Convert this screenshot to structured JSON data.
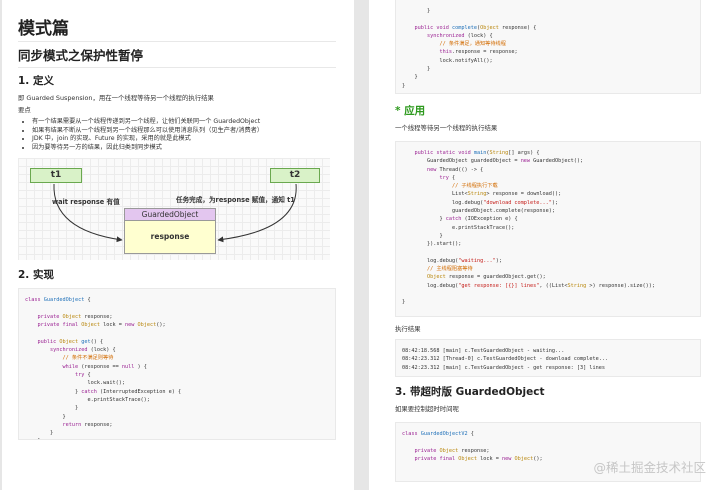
{
  "left": {
    "chapter": "模式篇",
    "section": "同步模式之保护性暂停",
    "h_def": "1. 定义",
    "def_text": "即 Guarded Suspension，用在一个线程等待另一个线程的执行结果",
    "points_label": "要点",
    "bullets": [
      "有一个结果需要从一个线程传递到另一个线程，让他们关联同一个 GuardedObject",
      "如果有结果不断从一个线程到另一个线程那么可以使用消息队列（见生产者/消费者）",
      "JDK 中，join 的实现、Future 的实现，采用的就是此模式",
      "因为要等待另一方的结果，因此归类到同步模式"
    ],
    "diagram": {
      "t1": "t1",
      "t2": "t2",
      "obj_title": "GuardedObject",
      "obj_body": "response",
      "left_label": "wait response 有值",
      "right_label": "任务完成，为response 赋值，通知 t1"
    },
    "h_impl": "2. 实现"
  },
  "right": {
    "h_app": "* 应用",
    "app_text": "一个线程等待另一个线程的执行结果",
    "result_label": "执行结果",
    "h_timeout": "3. 带超时版 GuardedObject",
    "timeout_text": "如果要控制超时时间呢"
  },
  "code1": [
    [
      [
        "k",
        "class"
      ],
      [
        "",
        " "
      ],
      [
        "f",
        "GuardedObject"
      ],
      [
        "",
        " {"
      ]
    ],
    [
      [
        "",
        ""
      ]
    ],
    [
      [
        "",
        "    "
      ],
      [
        "k",
        "private"
      ],
      [
        "",
        " "
      ],
      [
        "t",
        "Object"
      ],
      [
        "",
        " response;"
      ]
    ],
    [
      [
        "",
        "    "
      ],
      [
        "k",
        "private final"
      ],
      [
        "",
        " "
      ],
      [
        "t",
        "Object"
      ],
      [
        "",
        " lock = "
      ],
      [
        "k",
        "new"
      ],
      [
        "",
        " "
      ],
      [
        "t",
        "Object"
      ],
      [
        "",
        "();"
      ]
    ],
    [
      [
        "",
        ""
      ]
    ],
    [
      [
        "",
        "    "
      ],
      [
        "k",
        "public"
      ],
      [
        "",
        " "
      ],
      [
        "t",
        "Object"
      ],
      [
        "",
        " "
      ],
      [
        "f",
        "get"
      ],
      [
        "",
        "() {"
      ]
    ],
    [
      [
        "",
        "        "
      ],
      [
        "k",
        "synchronized"
      ],
      [
        "",
        " (lock) {"
      ]
    ],
    [
      [
        "",
        "            "
      ],
      [
        "c",
        "// 条件不满足则等待"
      ]
    ],
    [
      [
        "",
        "            "
      ],
      [
        "k",
        "while"
      ],
      [
        "",
        " (response == "
      ],
      [
        "k",
        "null"
      ],
      [
        "",
        " ) {"
      ]
    ],
    [
      [
        "",
        "                "
      ],
      [
        "k",
        "try"
      ],
      [
        "",
        " {"
      ]
    ],
    [
      [
        "",
        "                    lock.wait();"
      ]
    ],
    [
      [
        "",
        "                } "
      ],
      [
        "k",
        "catch"
      ],
      [
        "",
        " (InterruptedException e) {"
      ]
    ],
    [
      [
        "",
        "                    e.printStackTrace();"
      ]
    ],
    [
      [
        "",
        "                }"
      ]
    ],
    [
      [
        "",
        "            }"
      ]
    ],
    [
      [
        "",
        "            "
      ],
      [
        "k",
        "return"
      ],
      [
        "",
        " response;"
      ]
    ],
    [
      [
        "",
        "        }"
      ]
    ],
    [
      [
        "",
        "    }"
      ]
    ]
  ],
  "code2": [
    [
      [
        "",
        "        }"
      ]
    ],
    [
      [
        "",
        ""
      ]
    ],
    [
      [
        "",
        "    "
      ],
      [
        "k",
        "public void"
      ],
      [
        "",
        " "
      ],
      [
        "f",
        "complete"
      ],
      [
        "",
        "("
      ],
      [
        "t",
        "Object"
      ],
      [
        "",
        " response) {"
      ]
    ],
    [
      [
        "",
        "        "
      ],
      [
        "k",
        "synchronized"
      ],
      [
        "",
        " (lock) {"
      ]
    ],
    [
      [
        "",
        "            "
      ],
      [
        "c",
        "// 条件满足，通知等待线程"
      ]
    ],
    [
      [
        "",
        "            "
      ],
      [
        "k",
        "this"
      ],
      [
        "",
        ".response = response;"
      ]
    ],
    [
      [
        "",
        "            lock.notifyAll();"
      ]
    ],
    [
      [
        "",
        "        }"
      ]
    ],
    [
      [
        "",
        "    }"
      ]
    ],
    [
      [
        "",
        "}"
      ]
    ]
  ],
  "code3": [
    [
      [
        "",
        "    "
      ],
      [
        "k",
        "public static void"
      ],
      [
        "",
        " "
      ],
      [
        "f",
        "main"
      ],
      [
        "",
        "("
      ],
      [
        "t",
        "String"
      ],
      [
        "",
        "[] args) {"
      ]
    ],
    [
      [
        "",
        "        GuardedObject guardedObject = "
      ],
      [
        "k",
        "new"
      ],
      [
        "",
        " GuardedObject();"
      ]
    ],
    [
      [
        "",
        "        "
      ],
      [
        "k",
        "new"
      ],
      [
        "",
        " Thread(() -> {"
      ]
    ],
    [
      [
        "",
        "            "
      ],
      [
        "k",
        "try"
      ],
      [
        "",
        " {"
      ]
    ],
    [
      [
        "",
        "                "
      ],
      [
        "c",
        "// 子线程执行下载"
      ]
    ],
    [
      [
        "",
        "                List<"
      ],
      [
        "t",
        "String"
      ],
      [
        "",
        "> response = download();"
      ]
    ],
    [
      [
        "",
        "                log.debug("
      ],
      [
        "s",
        "\"download complete...\""
      ],
      [
        "",
        ");"
      ]
    ],
    [
      [
        "",
        "                guardedObject.complete(response);"
      ]
    ],
    [
      [
        "",
        "            } "
      ],
      [
        "k",
        "catch"
      ],
      [
        "",
        " (IOException e) {"
      ]
    ],
    [
      [
        "",
        "                e.printStackTrace();"
      ]
    ],
    [
      [
        "",
        "            }"
      ]
    ],
    [
      [
        "",
        "        }).start();"
      ]
    ],
    [
      [
        "",
        ""
      ]
    ],
    [
      [
        "",
        "        log.debug("
      ],
      [
        "s",
        "\"waiting...\""
      ],
      [
        "",
        ");"
      ]
    ],
    [
      [
        "",
        "        "
      ],
      [
        "c",
        "// 主线程阻塞等待"
      ]
    ],
    [
      [
        "",
        "        "
      ],
      [
        "t",
        "Object"
      ],
      [
        "",
        " response = guardedObject.get();"
      ]
    ],
    [
      [
        "",
        "        log.debug("
      ],
      [
        "s",
        "\"get response: [{}] lines\""
      ],
      [
        "",
        ", ((List<"
      ],
      [
        "t",
        "String"
      ],
      [
        "",
        " >) response).size());"
      ]
    ],
    [
      [
        "",
        ""
      ]
    ],
    [
      [
        "",
        "}"
      ]
    ]
  ],
  "code4": [
    [
      [
        "",
        "08:42:18.568 [main] c.TestGuardedObject - waiting..."
      ]
    ],
    [
      [
        "",
        "08:42:23.312 [Thread-0] c.TestGuardedObject - download complete..."
      ]
    ],
    [
      [
        "",
        "08:42:23.312 [main] c.TestGuardedObject - get response: [3] lines"
      ]
    ]
  ],
  "code5": [
    [
      [
        "k",
        "class"
      ],
      [
        "",
        " "
      ],
      [
        "f",
        "GuardedObjectV2"
      ],
      [
        "",
        " {"
      ]
    ],
    [
      [
        "",
        ""
      ]
    ],
    [
      [
        "",
        "    "
      ],
      [
        "k",
        "private"
      ],
      [
        "",
        " "
      ],
      [
        "t",
        "Object"
      ],
      [
        "",
        " response;"
      ]
    ],
    [
      [
        "",
        "    "
      ],
      [
        "k",
        "private final"
      ],
      [
        "",
        " "
      ],
      [
        "t",
        "Object"
      ],
      [
        "",
        " lock = "
      ],
      [
        "k",
        "new"
      ],
      [
        "",
        " "
      ],
      [
        "t",
        "Object"
      ],
      [
        "",
        "();"
      ]
    ]
  ],
  "watermark": "@稀土掘金技术社区"
}
